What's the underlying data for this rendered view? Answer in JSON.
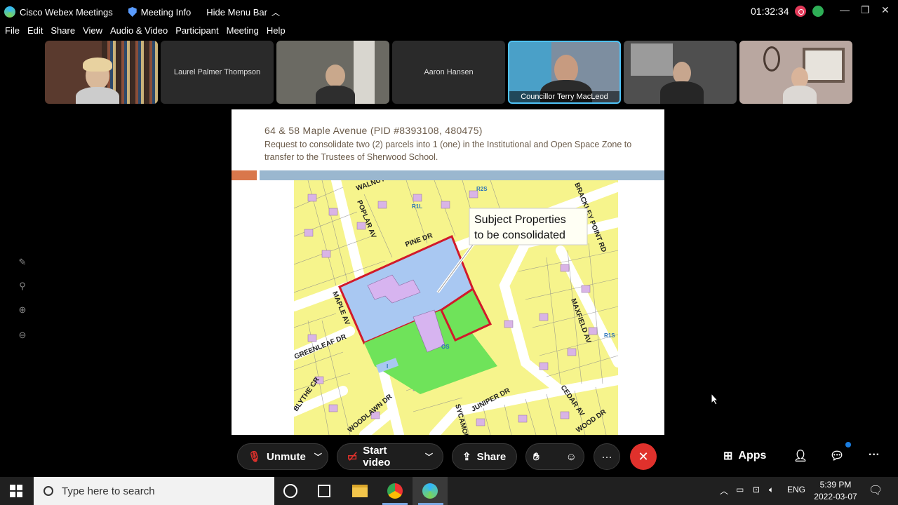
{
  "titlebar": {
    "app_name": "Cisco Webex Meetings",
    "meeting_info": "Meeting Info",
    "hide_menu": "Hide Menu Bar",
    "elapsed": "01:32:34"
  },
  "menu": [
    "File",
    "Edit",
    "Share",
    "View",
    "Audio & Video",
    "Participant",
    "Meeting",
    "Help"
  ],
  "participants": [
    {
      "name": "",
      "has_video": true
    },
    {
      "name": "Laurel Palmer Thompson",
      "has_video": false
    },
    {
      "name": "",
      "has_video": true
    },
    {
      "name": "Aaron Hansen",
      "has_video": false
    },
    {
      "name": "Councillor Terry MacLeod",
      "has_video": true,
      "active_speaker": true
    },
    {
      "name": "",
      "has_video": true
    },
    {
      "name": "",
      "has_video": true
    }
  ],
  "slide": {
    "title": "64 & 58 Maple Avenue (PID #8393108, 480475)",
    "description": "Request to consolidate two (2) parcels into 1 (one) in the Institutional and Open Space Zone to transfer to the Trustees of Sherwood School.",
    "callout_line1": "Subject Properties",
    "callout_line2": "to be consolidated",
    "streets": [
      "WALNUT DR",
      "POPLAR AV",
      "PINE DR",
      "MAPLE AV",
      "GREENLEAF DR",
      "BLYTHE CR",
      "WOODLAWN DR",
      "SYCAMORE",
      "JUNIPER DR",
      "CEDAR AV",
      "MAXFIELD AV",
      "BRACKLEY POINT RD",
      "WOOD DR"
    ],
    "zone_labels": [
      "R1L",
      "R2S",
      "OS",
      "I",
      "R1S"
    ]
  },
  "controls": {
    "unmute": "Unmute",
    "start_video": "Start video",
    "share": "Share",
    "apps": "Apps"
  },
  "taskbar": {
    "search_placeholder": "Type here to search",
    "language": "ENG",
    "time": "5:39 PM",
    "date": "2022-03-07"
  }
}
